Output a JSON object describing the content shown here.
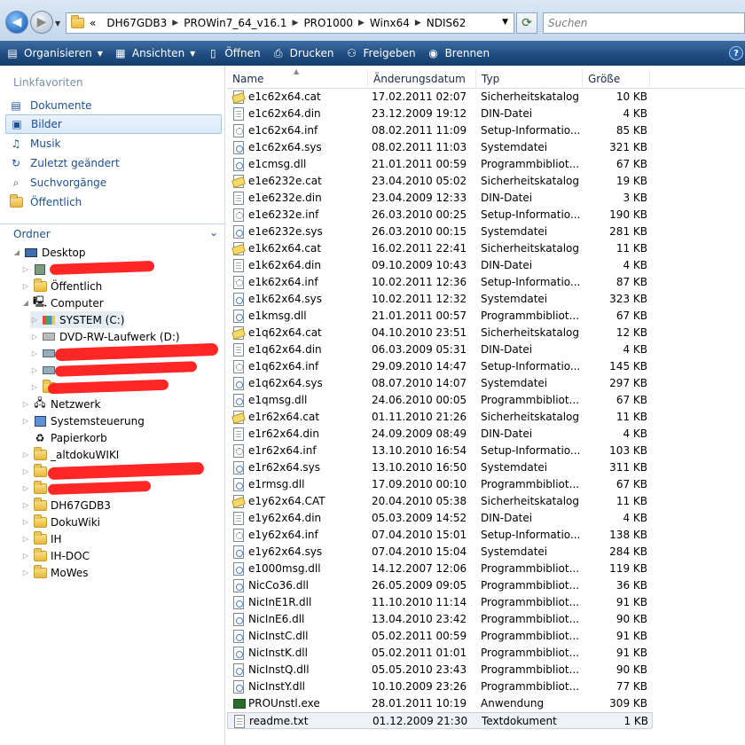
{
  "address": {
    "overflow": "«",
    "crumbs": [
      "DH67GDB3",
      "PROWin7_64_v16.1",
      "PRO1000",
      "Winx64",
      "NDIS62"
    ],
    "search_placeholder": "Suchen"
  },
  "toolbar": {
    "organize": "Organisieren",
    "views": "Ansichten",
    "open": "Öffnen",
    "print": "Drucken",
    "share": "Freigeben",
    "burn": "Brennen"
  },
  "sidebar": {
    "favorites_header": "Linkfavoriten",
    "favorites": [
      "Dokumente",
      "Bilder",
      "Musik",
      "Zuletzt geändert",
      "Suchvorgänge",
      "Öffentlich"
    ],
    "folders_header": "Ordner",
    "tree": {
      "desktop": "Desktop",
      "public": "Öffentlich",
      "computer": "Computer",
      "system_c": "SYSTEM (C:)",
      "dvd": "DVD-RW-Laufwerk (D:)",
      "network": "Netzwerk",
      "control_panel": "Systemsteuerung",
      "recycle_bin": "Papierkorb",
      "altdoku": "_altdokuWIKI",
      "dh67": "DH67GDB3",
      "dokuwiki": "DokuWiki",
      "ih": "IH",
      "ih_doc": "IH-DOC",
      "mowes": "MoWes"
    }
  },
  "columns": {
    "name": "Name",
    "date": "Änderungsdatum",
    "type": "Typ",
    "size": "Größe"
  },
  "files": [
    {
      "name": "e1c62x64.cat",
      "date": "17.02.2011 02:07",
      "type": "Sicherheitskatalog",
      "size": "10 KB",
      "icon": "cat"
    },
    {
      "name": "e1c62x64.din",
      "date": "23.12.2009 19:12",
      "type": "DIN-Datei",
      "size": "4 KB",
      "icon": "din"
    },
    {
      "name": "e1c62x64.inf",
      "date": "08.02.2011 11:09",
      "type": "Setup-Informatio...",
      "size": "85 KB",
      "icon": "inf"
    },
    {
      "name": "e1c62x64.sys",
      "date": "08.02.2011 11:03",
      "type": "Systemdatei",
      "size": "321 KB",
      "icon": "sys"
    },
    {
      "name": "e1cmsg.dll",
      "date": "21.01.2011 00:59",
      "type": "Programmbibliot...",
      "size": "67 KB",
      "icon": "dll"
    },
    {
      "name": "e1e6232e.cat",
      "date": "23.04.2010 05:02",
      "type": "Sicherheitskatalog",
      "size": "19 KB",
      "icon": "cat"
    },
    {
      "name": "e1e6232e.din",
      "date": "23.04.2009 12:33",
      "type": "DIN-Datei",
      "size": "3 KB",
      "icon": "din"
    },
    {
      "name": "e1e6232e.inf",
      "date": "26.03.2010 00:25",
      "type": "Setup-Informatio...",
      "size": "190 KB",
      "icon": "inf"
    },
    {
      "name": "e1e6232e.sys",
      "date": "26.03.2010 00:15",
      "type": "Systemdatei",
      "size": "281 KB",
      "icon": "sys"
    },
    {
      "name": "e1k62x64.cat",
      "date": "16.02.2011 22:41",
      "type": "Sicherheitskatalog",
      "size": "11 KB",
      "icon": "cat"
    },
    {
      "name": "e1k62x64.din",
      "date": "09.10.2009 10:43",
      "type": "DIN-Datei",
      "size": "4 KB",
      "icon": "din"
    },
    {
      "name": "e1k62x64.inf",
      "date": "10.02.2011 12:36",
      "type": "Setup-Informatio...",
      "size": "87 KB",
      "icon": "inf"
    },
    {
      "name": "e1k62x64.sys",
      "date": "10.02.2011 12:32",
      "type": "Systemdatei",
      "size": "323 KB",
      "icon": "sys"
    },
    {
      "name": "e1kmsg.dll",
      "date": "21.01.2011 00:57",
      "type": "Programmbibliot...",
      "size": "67 KB",
      "icon": "dll"
    },
    {
      "name": "e1q62x64.cat",
      "date": "04.10.2010 23:51",
      "type": "Sicherheitskatalog",
      "size": "12 KB",
      "icon": "cat"
    },
    {
      "name": "e1q62x64.din",
      "date": "06.03.2009 05:31",
      "type": "DIN-Datei",
      "size": "4 KB",
      "icon": "din"
    },
    {
      "name": "e1q62x64.inf",
      "date": "29.09.2010 14:47",
      "type": "Setup-Informatio...",
      "size": "145 KB",
      "icon": "inf"
    },
    {
      "name": "e1q62x64.sys",
      "date": "08.07.2010 14:07",
      "type": "Systemdatei",
      "size": "297 KB",
      "icon": "sys"
    },
    {
      "name": "e1qmsg.dll",
      "date": "24.06.2010 00:05",
      "type": "Programmbibliot...",
      "size": "67 KB",
      "icon": "dll"
    },
    {
      "name": "e1r62x64.cat",
      "date": "01.11.2010 21:26",
      "type": "Sicherheitskatalog",
      "size": "11 KB",
      "icon": "cat"
    },
    {
      "name": "e1r62x64.din",
      "date": "24.09.2009 08:49",
      "type": "DIN-Datei",
      "size": "4 KB",
      "icon": "din"
    },
    {
      "name": "e1r62x64.inf",
      "date": "13.10.2010 16:54",
      "type": "Setup-Informatio...",
      "size": "103 KB",
      "icon": "inf"
    },
    {
      "name": "e1r62x64.sys",
      "date": "13.10.2010 16:50",
      "type": "Systemdatei",
      "size": "311 KB",
      "icon": "sys"
    },
    {
      "name": "e1rmsg.dll",
      "date": "17.09.2010 00:10",
      "type": "Programmbibliot...",
      "size": "67 KB",
      "icon": "dll"
    },
    {
      "name": "e1y62x64.CAT",
      "date": "20.04.2010 05:38",
      "type": "Sicherheitskatalog",
      "size": "11 KB",
      "icon": "cat"
    },
    {
      "name": "e1y62x64.din",
      "date": "05.03.2009 14:52",
      "type": "DIN-Datei",
      "size": "4 KB",
      "icon": "din"
    },
    {
      "name": "e1y62x64.inf",
      "date": "07.04.2010 15:01",
      "type": "Setup-Informatio...",
      "size": "138 KB",
      "icon": "inf"
    },
    {
      "name": "e1y62x64.sys",
      "date": "07.04.2010 15:04",
      "type": "Systemdatei",
      "size": "284 KB",
      "icon": "sys"
    },
    {
      "name": "e1000msg.dll",
      "date": "14.12.2007 12:06",
      "type": "Programmbibliot...",
      "size": "119 KB",
      "icon": "dll"
    },
    {
      "name": "NicCo36.dll",
      "date": "26.05.2009 09:05",
      "type": "Programmbibliot...",
      "size": "36 KB",
      "icon": "dll"
    },
    {
      "name": "NicInE1R.dll",
      "date": "11.10.2010 11:14",
      "type": "Programmbibliot...",
      "size": "91 KB",
      "icon": "dll"
    },
    {
      "name": "NicInE6.dll",
      "date": "13.04.2010 23:42",
      "type": "Programmbibliot...",
      "size": "90 KB",
      "icon": "dll"
    },
    {
      "name": "NicInstC.dll",
      "date": "05.02.2011 00:59",
      "type": "Programmbibliot...",
      "size": "91 KB",
      "icon": "dll"
    },
    {
      "name": "NicInstK.dll",
      "date": "05.02.2011 01:01",
      "type": "Programmbibliot...",
      "size": "91 KB",
      "icon": "dll"
    },
    {
      "name": "NicInstQ.dll",
      "date": "05.05.2010 23:43",
      "type": "Programmbibliot...",
      "size": "90 KB",
      "icon": "dll"
    },
    {
      "name": "NicInstY.dll",
      "date": "10.10.2009 23:26",
      "type": "Programmbibliot...",
      "size": "77 KB",
      "icon": "dll"
    },
    {
      "name": "PROUnstl.exe",
      "date": "28.01.2011 10:19",
      "type": "Anwendung",
      "size": "309 KB",
      "icon": "exe"
    },
    {
      "name": "readme.txt",
      "date": "01.12.2009 21:30",
      "type": "Textdokument",
      "size": "1 KB",
      "icon": "txt",
      "selected": true
    }
  ]
}
